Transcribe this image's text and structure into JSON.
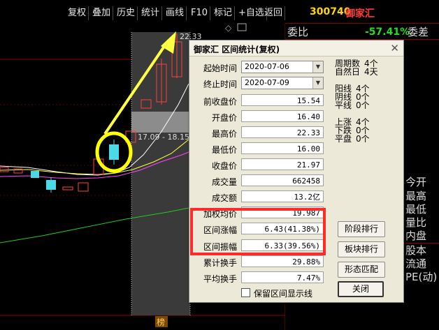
{
  "toolbar": {
    "buttons": [
      "复权",
      "叠加",
      "历史",
      "统计",
      "画线",
      "F10",
      "标记",
      "+自选",
      "返回"
    ],
    "stock_code": "300740",
    "stock_name": "御家汇"
  },
  "right_panel": {
    "weibi_label": "委比",
    "weibi_value": "-57.41%",
    "weicha_label": "委差",
    "labels": [
      "今开",
      "最高",
      "最低",
      "量比",
      "内盘",
      "股本",
      "流通",
      "PE(动)"
    ]
  },
  "chart": {
    "price_top_label": "22.33",
    "range_label": "17.09 - 18.15",
    "bottom_tag": "榜"
  },
  "dialog": {
    "title": "御家汇 区间统计(复权)",
    "start_label": "起始时间",
    "start_value": "2020-07-06",
    "end_label": "终止时间",
    "end_value": "2020-07-09",
    "rows": [
      {
        "label": "前收盘价",
        "value": "15.54"
      },
      {
        "label": "开盘价",
        "value": "16.40"
      },
      {
        "label": "最高价",
        "value": "22.33"
      },
      {
        "label": "最低价",
        "value": "16.00"
      },
      {
        "label": "收盘价",
        "value": "21.97"
      },
      {
        "label": "成交量",
        "value": "662458"
      },
      {
        "label": "成交额",
        "value": "13.2亿"
      },
      {
        "label": "加权均价",
        "value": "19.987"
      },
      {
        "label": "区间涨幅",
        "value": "6.43(41.38%)"
      },
      {
        "label": "区间振幅",
        "value": "6.33(39.56%)"
      },
      {
        "label": "累计换手",
        "value": "29.88%"
      },
      {
        "label": "平均换手",
        "value": "7.47%"
      }
    ],
    "stats": {
      "periods_label": "周期数",
      "periods_value": "4个",
      "natural_days_label": "自然日",
      "natural_days_value": "4天",
      "yang_label": "阳线",
      "yang_value": "4个",
      "yin_label": "阴线",
      "yin_value": "0个",
      "flat_label": "平线",
      "flat_value": "0个",
      "up_label": "上涨",
      "up_value": "4个",
      "down_label": "下跌",
      "down_value": "0个",
      "even_label": "平盘",
      "even_value": "0个"
    },
    "buttons": {
      "stage_rank": "阶段排行",
      "sector_rank": "板块排行",
      "pattern_match": "形态匹配",
      "close": "关闭"
    },
    "checkbox_label": "保留区间显示线"
  }
}
